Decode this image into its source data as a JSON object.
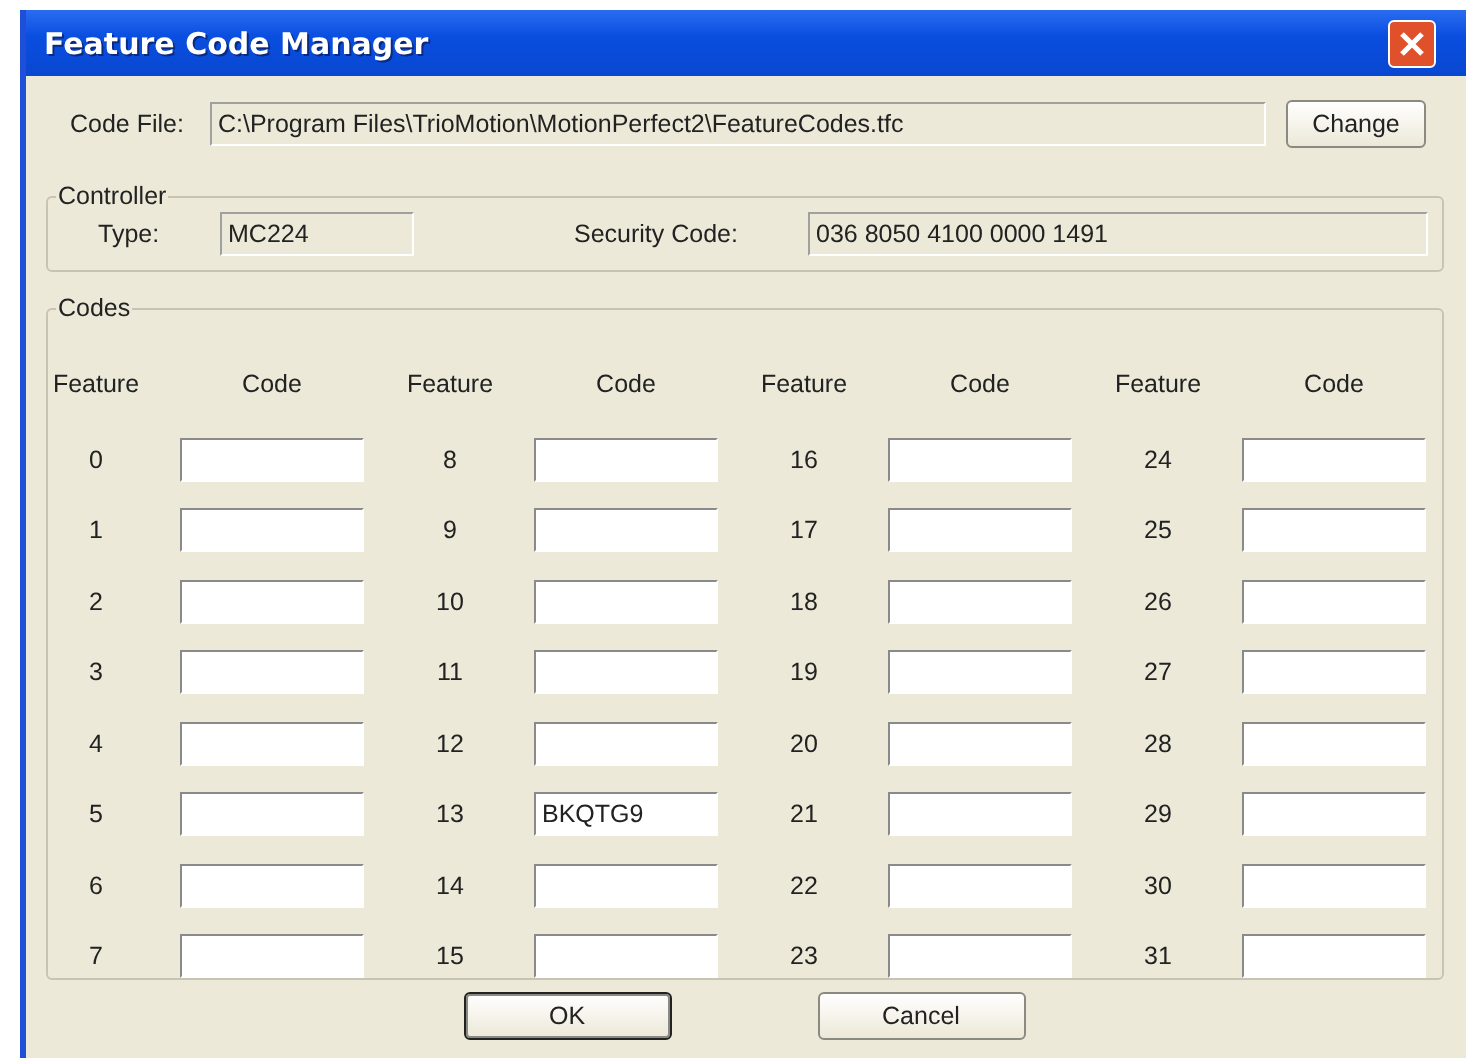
{
  "window": {
    "title": "Feature Code Manager"
  },
  "code_file": {
    "label": "Code File:",
    "value": "C:\\Program Files\\TrioMotion\\MotionPerfect2\\FeatureCodes.tfc",
    "button": "Change"
  },
  "controller": {
    "legend": "Controller",
    "type_label": "Type:",
    "type_value": "MC224",
    "security_label": "Security Code:",
    "security_value": "036 8050 4100 0000 1491"
  },
  "codes": {
    "legend": "Codes",
    "columns": [
      {
        "feature_heading": "Feature",
        "code_heading": "Code",
        "rows": [
          {
            "feature": "0"
          },
          {
            "feature": "1"
          },
          {
            "feature": "2"
          },
          {
            "feature": "3"
          },
          {
            "feature": "4"
          },
          {
            "feature": "5"
          },
          {
            "feature": "6"
          },
          {
            "feature": "7"
          }
        ]
      },
      {
        "feature_heading": "Feature",
        "code_heading": "Code",
        "rows": [
          {
            "feature": "8"
          },
          {
            "feature": "9"
          },
          {
            "feature": "10"
          },
          {
            "feature": "11"
          },
          {
            "feature": "12"
          },
          {
            "feature": "13",
            "code": "BKQTG9"
          },
          {
            "feature": "14"
          },
          {
            "feature": "15"
          }
        ]
      },
      {
        "feature_heading": "Feature",
        "code_heading": "Code",
        "rows": [
          {
            "feature": "16"
          },
          {
            "feature": "17"
          },
          {
            "feature": "18"
          },
          {
            "feature": "19"
          },
          {
            "feature": "20"
          },
          {
            "feature": "21"
          },
          {
            "feature": "22"
          },
          {
            "feature": "23"
          }
        ]
      },
      {
        "feature_heading": "Feature",
        "code_heading": "Code",
        "rows": [
          {
            "feature": "24"
          },
          {
            "feature": "25"
          },
          {
            "feature": "26"
          },
          {
            "feature": "27"
          },
          {
            "feature": "28"
          },
          {
            "feature": "29"
          },
          {
            "feature": "30"
          },
          {
            "feature": "31"
          }
        ]
      }
    ]
  },
  "buttons": [
    {
      "label": "OK",
      "default": true
    },
    {
      "label": "Cancel",
      "default": false
    }
  ]
}
